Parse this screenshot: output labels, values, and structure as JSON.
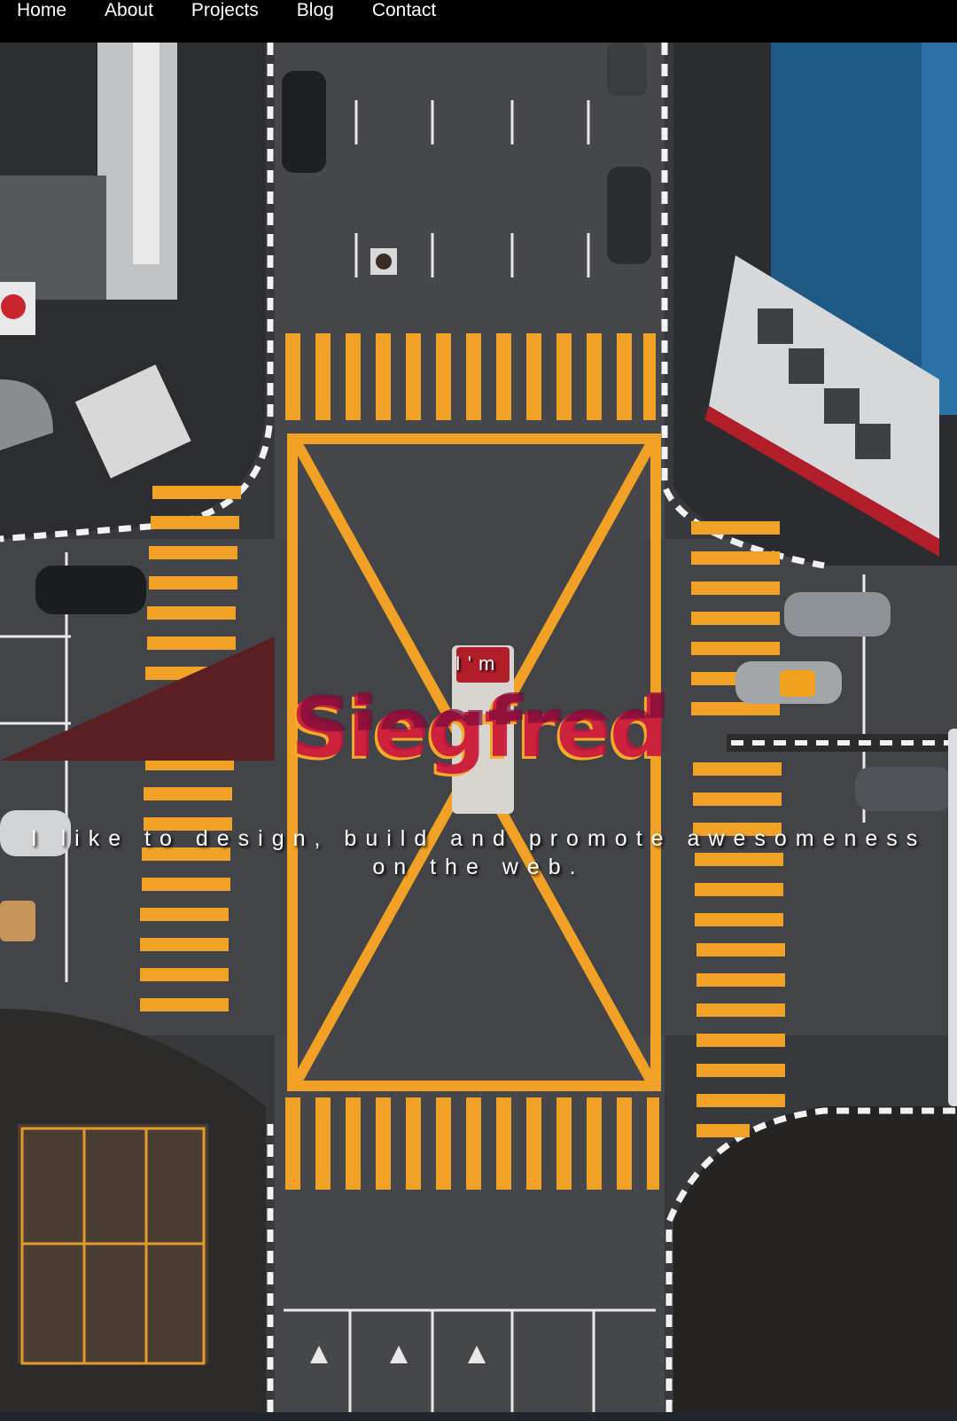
{
  "nav": {
    "items": [
      {
        "label": "Home"
      },
      {
        "label": "About"
      },
      {
        "label": "Projects"
      },
      {
        "label": "Blog"
      },
      {
        "label": "Contact"
      }
    ]
  },
  "hero": {
    "intro": "I'm",
    "name": "Siegfred",
    "tagline": "I like to design, build and promote awesomeness on the web.",
    "background": "aerial-road-intersection-photo"
  },
  "colors": {
    "nav_bg": "#000000",
    "road": "#3b3d40",
    "road_marking": "#f1a126",
    "name_primary": "#f4a92a",
    "name_secondary": "#c8103f",
    "text": "#ffffff"
  }
}
